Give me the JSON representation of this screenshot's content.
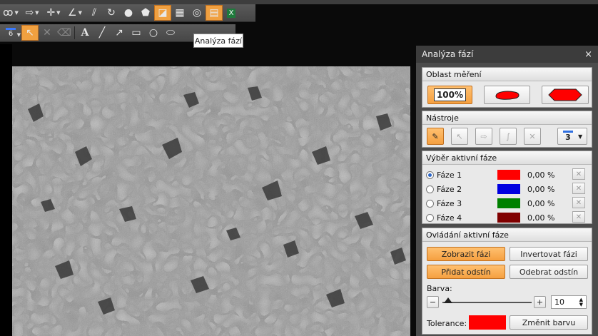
{
  "tooltip": {
    "text": "Analýza fází"
  },
  "toolbar2": {
    "line_width": "6"
  },
  "panel": {
    "title": "Analýza fází",
    "close": "×",
    "area": {
      "header": "Oblast měření",
      "full_label": "100%"
    },
    "tools": {
      "header": "Nástroje",
      "line_width": "3"
    },
    "phase_select": {
      "header": "Výběr aktivní fáze",
      "phases": [
        {
          "name": "Fáze 1",
          "color": "#ff0000",
          "percent": "0,00 %",
          "selected": true
        },
        {
          "name": "Fáze 2",
          "color": "#0000e0",
          "percent": "0,00 %",
          "selected": false
        },
        {
          "name": "Fáze 3",
          "color": "#008000",
          "percent": "0,00 %",
          "selected": false
        },
        {
          "name": "Fáze 4",
          "color": "#800000",
          "percent": "0,00 %",
          "selected": false
        }
      ]
    },
    "phase_control": {
      "header": "Ovládání aktivní fáze",
      "show_phase": "Zobrazit fázi",
      "invert_phase": "Invertovat fázi",
      "add_shade": "Přidat odstín",
      "remove_shade": "Odebrat odstín",
      "color_label": "Barva:",
      "minus": "−",
      "plus": "+",
      "tolerance_value": "10",
      "tolerance_label": "Tolerance:",
      "tolerance_color": "#ff0000",
      "change_color": "Změnit barvu"
    }
  }
}
